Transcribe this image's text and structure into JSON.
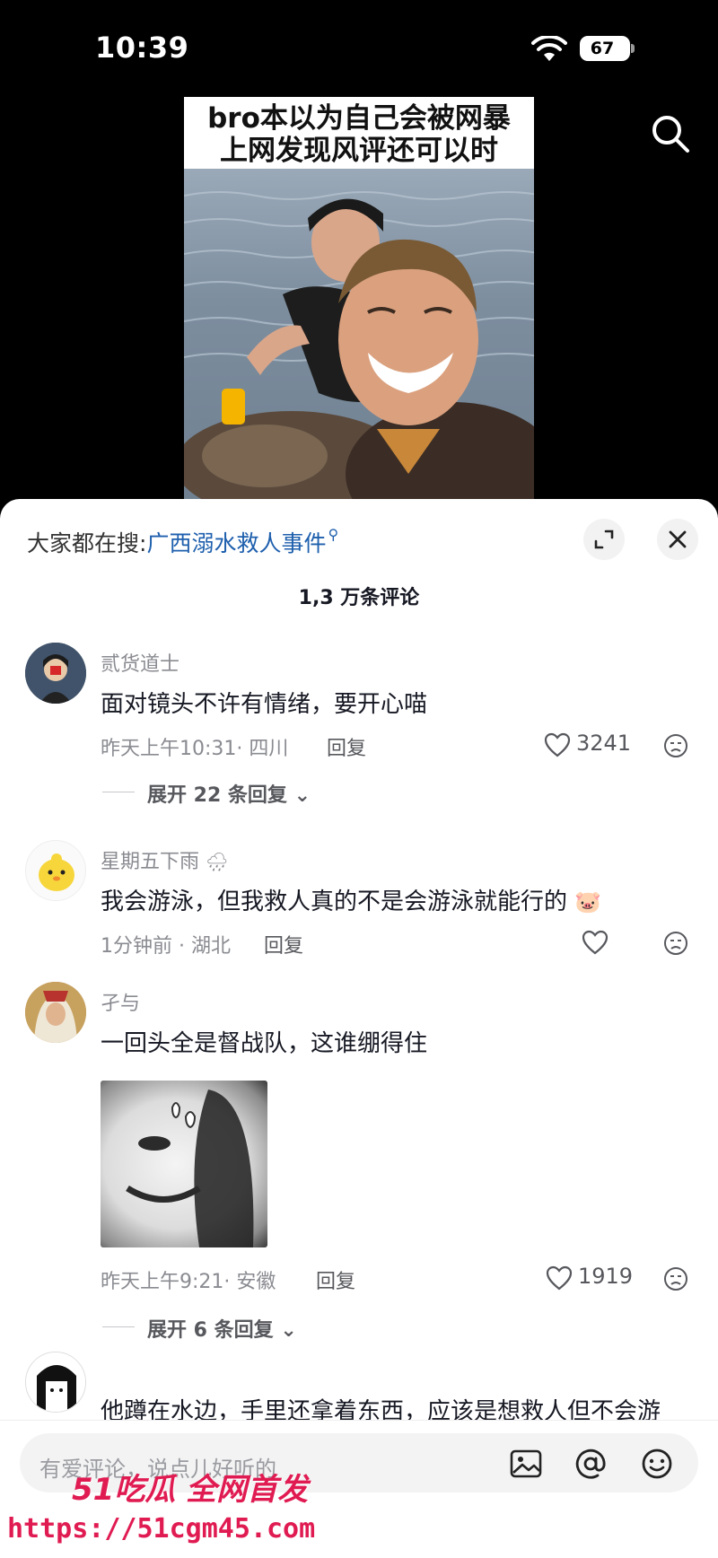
{
  "status_bar": {
    "time": "10:39",
    "battery": "67"
  },
  "video": {
    "caption_line1": "bro本以为自己会被网暴",
    "caption_line2": "上网发现风评还可以时"
  },
  "sheet": {
    "trending_prefix": "大家都在搜:",
    "trending_query": "广西溺水救人事件",
    "comment_count": "1,3 万条评论"
  },
  "comments": [
    {
      "name": "贰货道士",
      "text": "面对镜头不许有情绪，要开心喵",
      "meta": "昨天上午10:31· 四川",
      "reply": "回复",
      "likes": "3241",
      "expand": "展开 22 条回复"
    },
    {
      "name": "星期五下雨",
      "text": "我会游泳，但我救人真的不是会游泳就能行的",
      "meta": "1分钟前 · 湖北",
      "reply": "回复",
      "likes": ""
    },
    {
      "name": "孑与",
      "text": "一回头全是督战队，这谁绷得住",
      "meta": "昨天上午9:21· 安徽",
      "reply": "回复",
      "likes": "1919",
      "expand": "展开 6 条回复"
    },
    {
      "name": "",
      "text": "他蹲在水边，手里还拿着东西，应该是想救人但不会游"
    }
  ],
  "input": {
    "placeholder": "有爱评论，说点儿好听的"
  },
  "watermark": {
    "line1": "51吃瓜 全网首发",
    "line2": "https://51cgm45.com"
  }
}
